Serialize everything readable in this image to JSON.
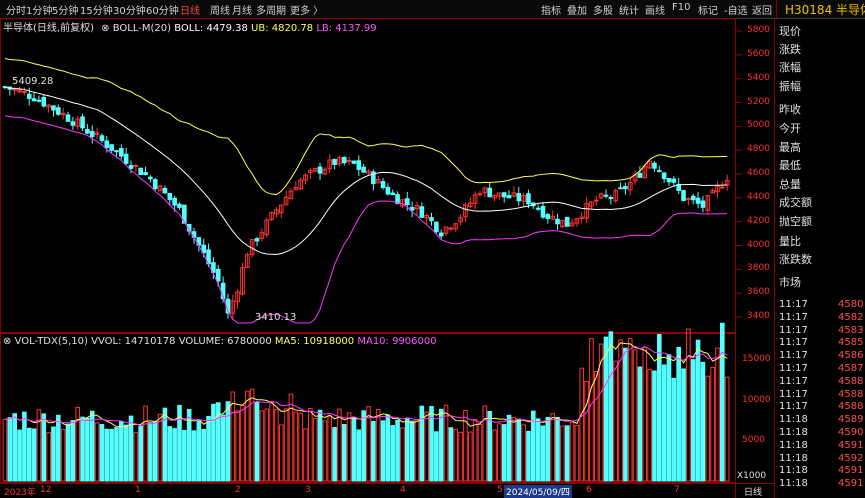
{
  "toolbar": {
    "periods": [
      "分时",
      "1分钟",
      "5分钟",
      "15分钟",
      "30分钟",
      "60分钟",
      "日线",
      "周线",
      "月线",
      "多周期",
      "更多 〉"
    ],
    "active_period": "日线",
    "right_items": [
      "指标",
      "叠加",
      "多股",
      "统计",
      "画线",
      "F10",
      "标记",
      "-自选",
      "返回"
    ],
    "code": "H30184",
    "name": "半导体"
  },
  "main_info": {
    "title": "半导体(日线,前复权)",
    "indicator": "BOLL-M(20)",
    "boll": "BOLL: 4479.38",
    "ub": "UB: 4820.78",
    "lb": "LB: 4137.99"
  },
  "vol_info": {
    "indicator": "VOL-TDX(5,10)",
    "vvol": "VVOL: 14710178",
    "volume": "VOLUME: 6780000",
    "ma5": "MA5: 10918000",
    "ma10": "MA10: 9906000"
  },
  "price_axis": [
    "5800",
    "5600",
    "5400",
    "5200",
    "5000",
    "4800",
    "4600",
    "4400",
    "4200",
    "4000",
    "3800",
    "3600",
    "3400"
  ],
  "vol_axis": [
    "15000",
    "10000",
    "5000"
  ],
  "vol_unit": "X1000",
  "annotations": {
    "high": "5409.28",
    "low": "3410.13"
  },
  "date_axis": [
    "2023年",
    "12",
    "1",
    "2",
    "3",
    "4",
    "5",
    "6",
    "7"
  ],
  "date_highlight": "2024/05/09/四",
  "bottom_tab": "日线",
  "panel_fields": [
    "现价",
    "涨跌",
    "涨幅",
    "振幅",
    "昨收",
    "今开",
    "最高",
    "最低",
    "总量",
    "成交额",
    "抛空额",
    "量比",
    "涨跌数",
    "市场"
  ],
  "ticks": [
    {
      "time": "11:17",
      "price": "4580"
    },
    {
      "time": "11:17",
      "price": "4582"
    },
    {
      "time": "11:17",
      "price": "4583"
    },
    {
      "time": "11:17",
      "price": "4585"
    },
    {
      "time": "11:17",
      "price": "4586"
    },
    {
      "time": "11:17",
      "price": "4587"
    },
    {
      "time": "11:17",
      "price": "4588"
    },
    {
      "time": "11:17",
      "price": "4588"
    },
    {
      "time": "11:17",
      "price": "4588"
    },
    {
      "time": "11:18",
      "price": "4589"
    },
    {
      "time": "11:18",
      "price": "4590"
    },
    {
      "time": "11:18",
      "price": "4591"
    },
    {
      "time": "11:18",
      "price": "4592"
    },
    {
      "time": "11:18",
      "price": "4591"
    },
    {
      "time": "11:18",
      "price": "4591"
    }
  ],
  "colors": {
    "up": "#ff3232",
    "down": "#54ffff",
    "boll": "#ffffff",
    "ub": "#ffff55",
    "lb": "#ff33ff",
    "ma5": "#ffff55",
    "ma10": "#ff33ff",
    "grid": "#8b0000"
  },
  "chart_data": {
    "type": "candlestick",
    "price_range": [
      3300,
      5900
    ],
    "volume_range_x1000": [
      0,
      18000
    ],
    "candles": []
  }
}
